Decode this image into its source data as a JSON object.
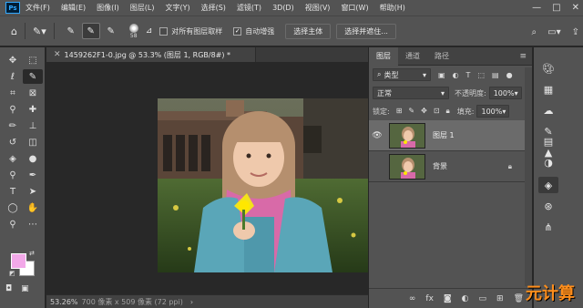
{
  "app": {
    "logo": "Ps"
  },
  "menu": [
    "文件(F)",
    "编辑(E)",
    "图像(I)",
    "图层(L)",
    "文字(Y)",
    "选择(S)",
    "滤镜(T)",
    "3D(D)",
    "视图(V)",
    "窗口(W)",
    "帮助(H)"
  ],
  "window_controls": [
    "—",
    "□",
    "✕"
  ],
  "options": {
    "brush_size": "58",
    "sample_all_layers": "对所有图层取样",
    "sample_all_checked": false,
    "auto_enhance": "自动增强",
    "auto_enhance_checked": true,
    "select_subject": "选择主体",
    "select_and_mask": "选择并遮住..."
  },
  "document": {
    "tab_title": "1459262F1-0.jpg @ 53.3% (图层 1, RGB/8#) *"
  },
  "status": {
    "zoom": "53.26%",
    "dimensions": "700 像素 x 509 像素 (72 ppi)"
  },
  "layers_panel": {
    "tabs": [
      "图层",
      "通道",
      "路径"
    ],
    "filter_kind": "类型",
    "blend_mode": "正常",
    "opacity_label": "不透明度:",
    "opacity_value": "100%",
    "lock_label": "锁定:",
    "fill_label": "填充:",
    "fill_value": "100%",
    "layers": [
      {
        "name": "图层 1",
        "visible": true,
        "selected": true,
        "locked": false
      },
      {
        "name": "背景",
        "visible": false,
        "selected": false,
        "locked": true
      }
    ]
  },
  "colors": {
    "foreground": "#f2a8e8",
    "background": "#ffffff",
    "accent": "#31a8ff"
  },
  "watermark": "元计算"
}
